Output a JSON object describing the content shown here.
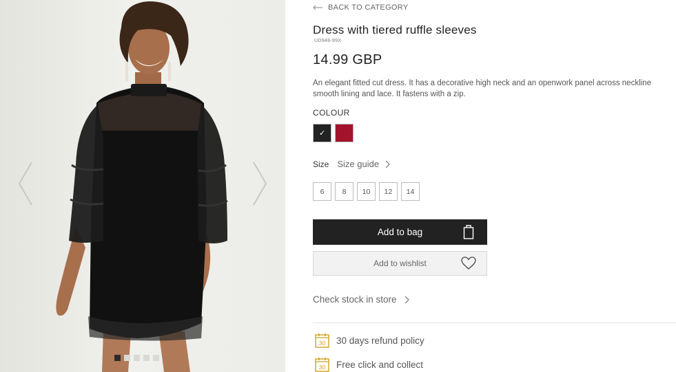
{
  "navigation": {
    "back_label": "BACK TO CATEGORY"
  },
  "product": {
    "title": "Dress with tiered ruffle sleeves",
    "sku": "UD948-99X",
    "price": "14.99 GBP",
    "description": "An elegant fitted cut dress. It has a decorative high neck and an openwork panel across neckline smooth lining and lace. It fastens with a zip."
  },
  "colour": {
    "label": "COLOUR",
    "swatches": [
      {
        "name": "black",
        "color": "#222222",
        "selected": true,
        "check": "✓"
      },
      {
        "name": "red",
        "color": "#a3142c",
        "selected": false
      }
    ]
  },
  "size": {
    "label": "Size",
    "guide_label": "Size guide",
    "options": [
      "6",
      "8",
      "10",
      "12",
      "14"
    ]
  },
  "actions": {
    "add_to_bag": "Add to bag",
    "add_to_wishlist": "Add to wishlist"
  },
  "stock_label": "Check stock in store",
  "perks": [
    {
      "icon": "calendar-30-icon",
      "icon_text": "30",
      "label": "30 days refund policy"
    },
    {
      "icon": "calendar-30-icon",
      "icon_text": "30",
      "label": "Free click and collect"
    }
  ],
  "gallery": {
    "image_count": 5,
    "active_index": 0
  },
  "colors": {
    "accent": "#222222",
    "perk_icon": "#d4a017",
    "muted_text": "#666666"
  }
}
